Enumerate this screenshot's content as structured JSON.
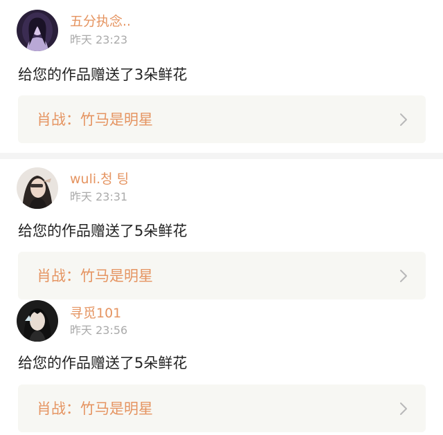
{
  "feed": [
    {
      "user": "五分执念..",
      "time": "昨天 23:23",
      "message": "给您的作品赠送了3朵鲜花",
      "work_title": "肖战：竹马是明星"
    },
    {
      "user": "wuli.청 팅",
      "time": "昨天 23:31",
      "message": "给您的作品赠送了5朵鲜花",
      "work_title": "肖战：竹马是明星"
    },
    {
      "user": "寻觅101",
      "time": "昨天 23:56",
      "message": "给您的作品赠送了5朵鲜花",
      "work_title": "肖战：竹马是明星"
    }
  ],
  "colors": {
    "accent": "#e59461",
    "card_bg": "#f7f7f3",
    "timestamp": "#aaaaaa",
    "text": "#222222",
    "divider": "#f4f4f4"
  },
  "icons": {
    "card_chevron": "chevron-right-icon"
  }
}
